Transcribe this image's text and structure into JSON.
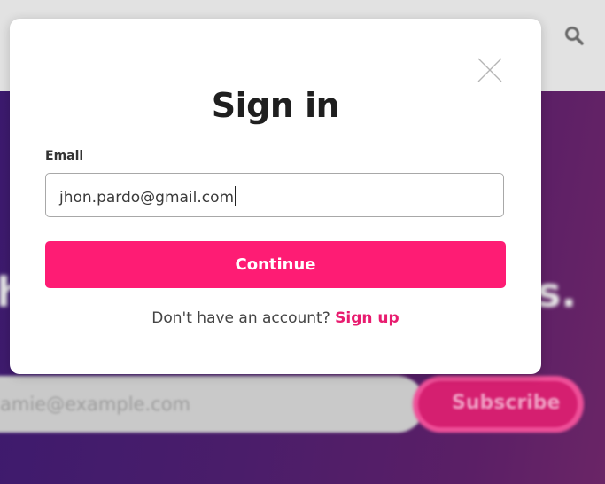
{
  "background": {
    "hero_left_text": "h",
    "hero_right_text": "s.",
    "email_placeholder": "amie@example.com",
    "subscribe_label": "Subscribe",
    "search_icon": "search-icon"
  },
  "modal": {
    "title": "Sign in",
    "close_icon": "close-icon",
    "email_label": "Email",
    "email_value": "jhon.pardo@gmail.com",
    "continue_label": "Continue",
    "signup_prompt": "Don't have an account?",
    "signup_link": "Sign up"
  },
  "colors": {
    "accent": "#fe1c74",
    "link": "#e81c6f",
    "hero_gradient_start": "#3c1a6e",
    "hero_gradient_end": "#6a2566"
  }
}
